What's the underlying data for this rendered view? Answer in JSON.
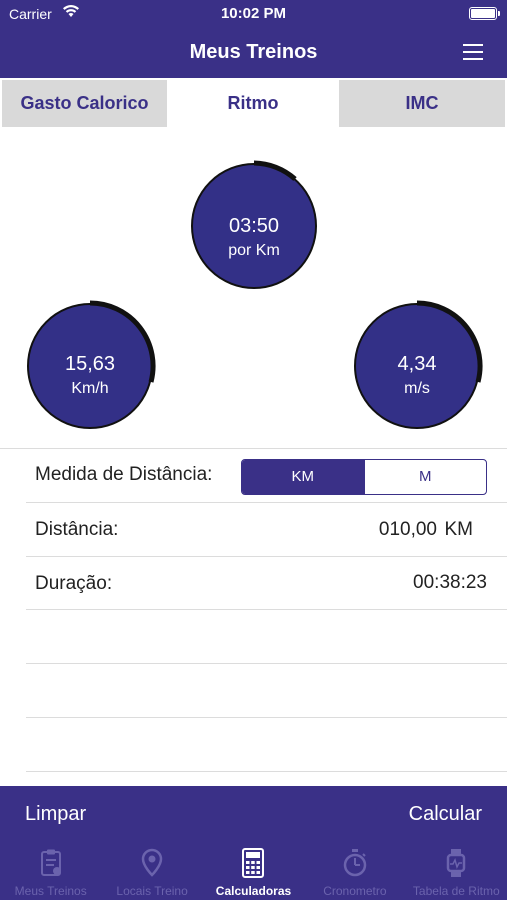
{
  "status": {
    "carrier": "Carrier",
    "time": "10:02 PM"
  },
  "nav": {
    "title": "Meus Treinos"
  },
  "tabs": [
    {
      "label": "Gasto Calorico",
      "active": false
    },
    {
      "label": "Ritmo",
      "active": true
    },
    {
      "label": "IMC",
      "active": false
    }
  ],
  "gauges": {
    "pace": {
      "value": "03:50",
      "unit": "por Km"
    },
    "speed_kmh": {
      "value": "15,63",
      "unit": "Km/h"
    },
    "speed_ms": {
      "value": "4,34",
      "unit": "m/s"
    }
  },
  "form": {
    "distance_unit_label": "Medida de Distância:",
    "distance_unit_options": [
      "KM",
      "M"
    ],
    "distance_unit_selected": "KM",
    "distance_label": "Distância:",
    "distance_value": "010,00",
    "distance_unit": "KM",
    "duration_label": "Duração:",
    "duration_value": "00:38:23"
  },
  "actions": {
    "clear": "Limpar",
    "calculate": "Calcular"
  },
  "tabbar": [
    {
      "label": "Meus Treinos",
      "icon": "clipboard-icon",
      "active": false
    },
    {
      "label": "Locais Treino",
      "icon": "map-pin-icon",
      "active": false
    },
    {
      "label": "Calculadoras",
      "icon": "calculator-icon",
      "active": true
    },
    {
      "label": "Cronometro",
      "icon": "stopwatch-icon",
      "active": false
    },
    {
      "label": "Tabela de Ritmo",
      "icon": "watch-icon",
      "active": false
    }
  ],
  "colors": {
    "primary": "#3a3087",
    "gauge_fill": "#333087",
    "tab_inactive": "#6b63ad",
    "tab_bg_inactive": "#d9d9d9"
  }
}
